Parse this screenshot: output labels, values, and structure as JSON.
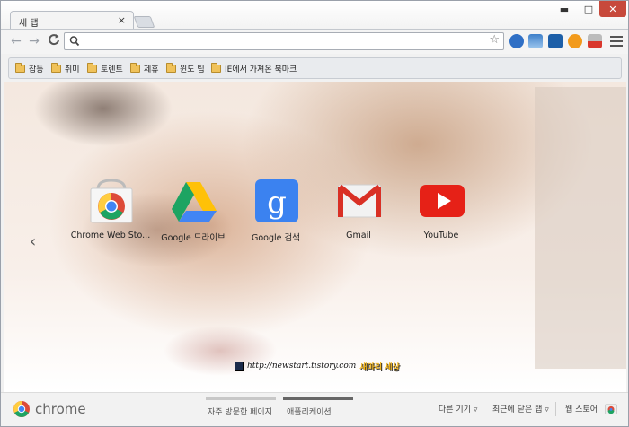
{
  "tab": {
    "title": "새 탭",
    "close": "×"
  },
  "window_controls": {
    "minimize": "▬",
    "maximize": "□",
    "close": "✕"
  },
  "nav": {
    "back": "←",
    "forward": "→",
    "reload": "C"
  },
  "omnibox": {
    "value": "",
    "star": "☆"
  },
  "extensions": [
    "info-extension-icon",
    "weather-extension-icon",
    "ipa-extension-icon",
    "amazon-extension-icon",
    "download-extension-icon"
  ],
  "bookmarks": [
    "잡동",
    "취미",
    "토렌트",
    "제휴",
    "윈도 팁",
    "IE에서 가져온 북마크"
  ],
  "apps": [
    {
      "label": "Chrome Web Sto...",
      "icon": "chrome-web-store-icon"
    },
    {
      "label": "Google 드라이브",
      "icon": "google-drive-icon"
    },
    {
      "label": "Google 검색",
      "icon": "google-search-icon"
    },
    {
      "label": "Gmail",
      "icon": "gmail-icon"
    },
    {
      "label": "YouTube",
      "icon": "youtube-icon"
    }
  ],
  "prev_arrow": "‹",
  "watermark": {
    "url": "http://newstart.tistory.com",
    "name": "새마리 세상"
  },
  "bottom": {
    "logo": "chrome",
    "sections": [
      "자주 방문한 페이지",
      "애플리케이션"
    ],
    "active_section": 1,
    "other_devices": "다른 기기 ▿",
    "recently_closed": "최근에 닫은 탭 ▿",
    "web_store": "웹 스토어"
  },
  "colors": {
    "accent_close": "#c7493b",
    "youtube": "#e62117",
    "drive_green": "#1da462",
    "drive_yellow": "#ffc107",
    "drive_blue": "#4285f4"
  }
}
